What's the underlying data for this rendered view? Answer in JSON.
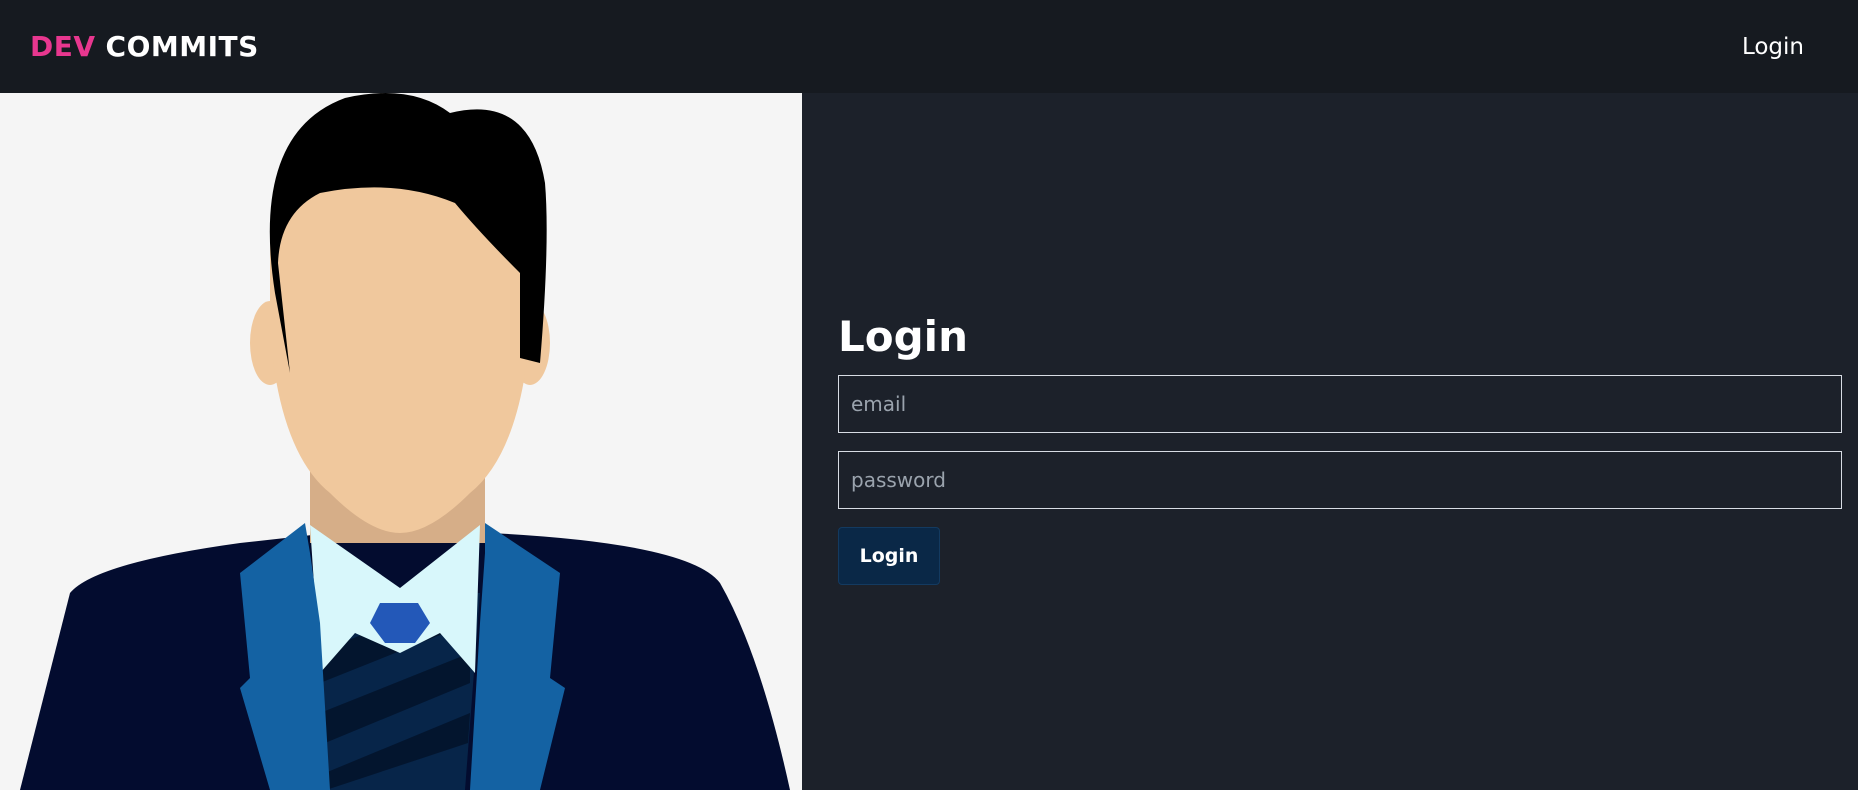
{
  "navbar": {
    "brand_accent": "DEV",
    "brand_main": "COMMITS",
    "login_link": "Login"
  },
  "hero": {
    "illustration": "businessman-avatar"
  },
  "login_form": {
    "title": "Login",
    "email_placeholder": "email",
    "password_placeholder": "password",
    "submit_label": "Login"
  },
  "colors": {
    "navbar_bg": "#161a20",
    "panel_bg": "#1c212a",
    "brand_accent": "#e8378f",
    "button_bg": "#0a2847",
    "hero_bg": "#f5f5f5"
  }
}
